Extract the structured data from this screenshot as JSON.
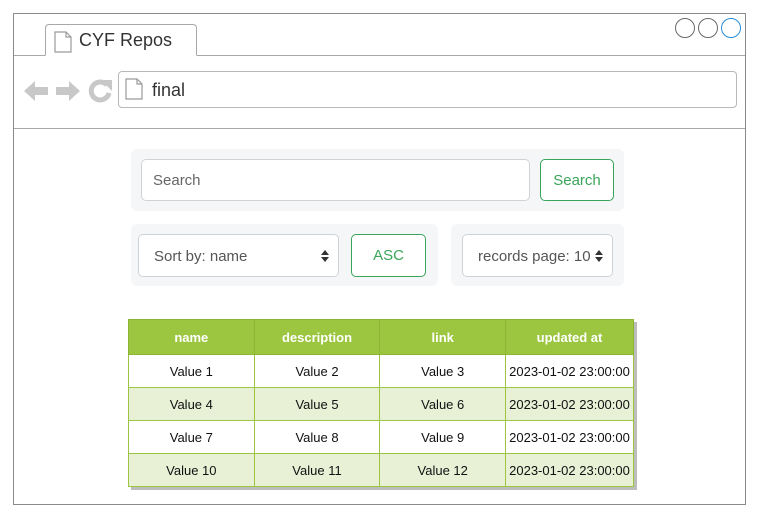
{
  "window": {
    "tab_title": "CYF Repos",
    "address": "final"
  },
  "search": {
    "placeholder": "Search",
    "button_label": "Search"
  },
  "sort": {
    "selected": "Sort by: name",
    "order_label": "ASC"
  },
  "records": {
    "selected": "records page: 10"
  },
  "table": {
    "headers": [
      "name",
      "description",
      "link",
      "updated at"
    ],
    "rows": [
      [
        "Value 1",
        "Value 2",
        "Value 3",
        "2023-01-02 23:00:00"
      ],
      [
        "Value 4",
        "Value 5",
        "Value 6",
        "2023-01-02 23:00:00"
      ],
      [
        "Value 7",
        "Value 8",
        "Value 9",
        "2023-01-02 23:00:00"
      ],
      [
        "Value 10",
        "Value 11",
        "Value 12",
        "2023-01-02 23:00:00"
      ]
    ]
  },
  "colors": {
    "accent_green": "#3aa55a",
    "table_header": "#9cc63f",
    "table_alt_row": "#e8f0d6"
  }
}
